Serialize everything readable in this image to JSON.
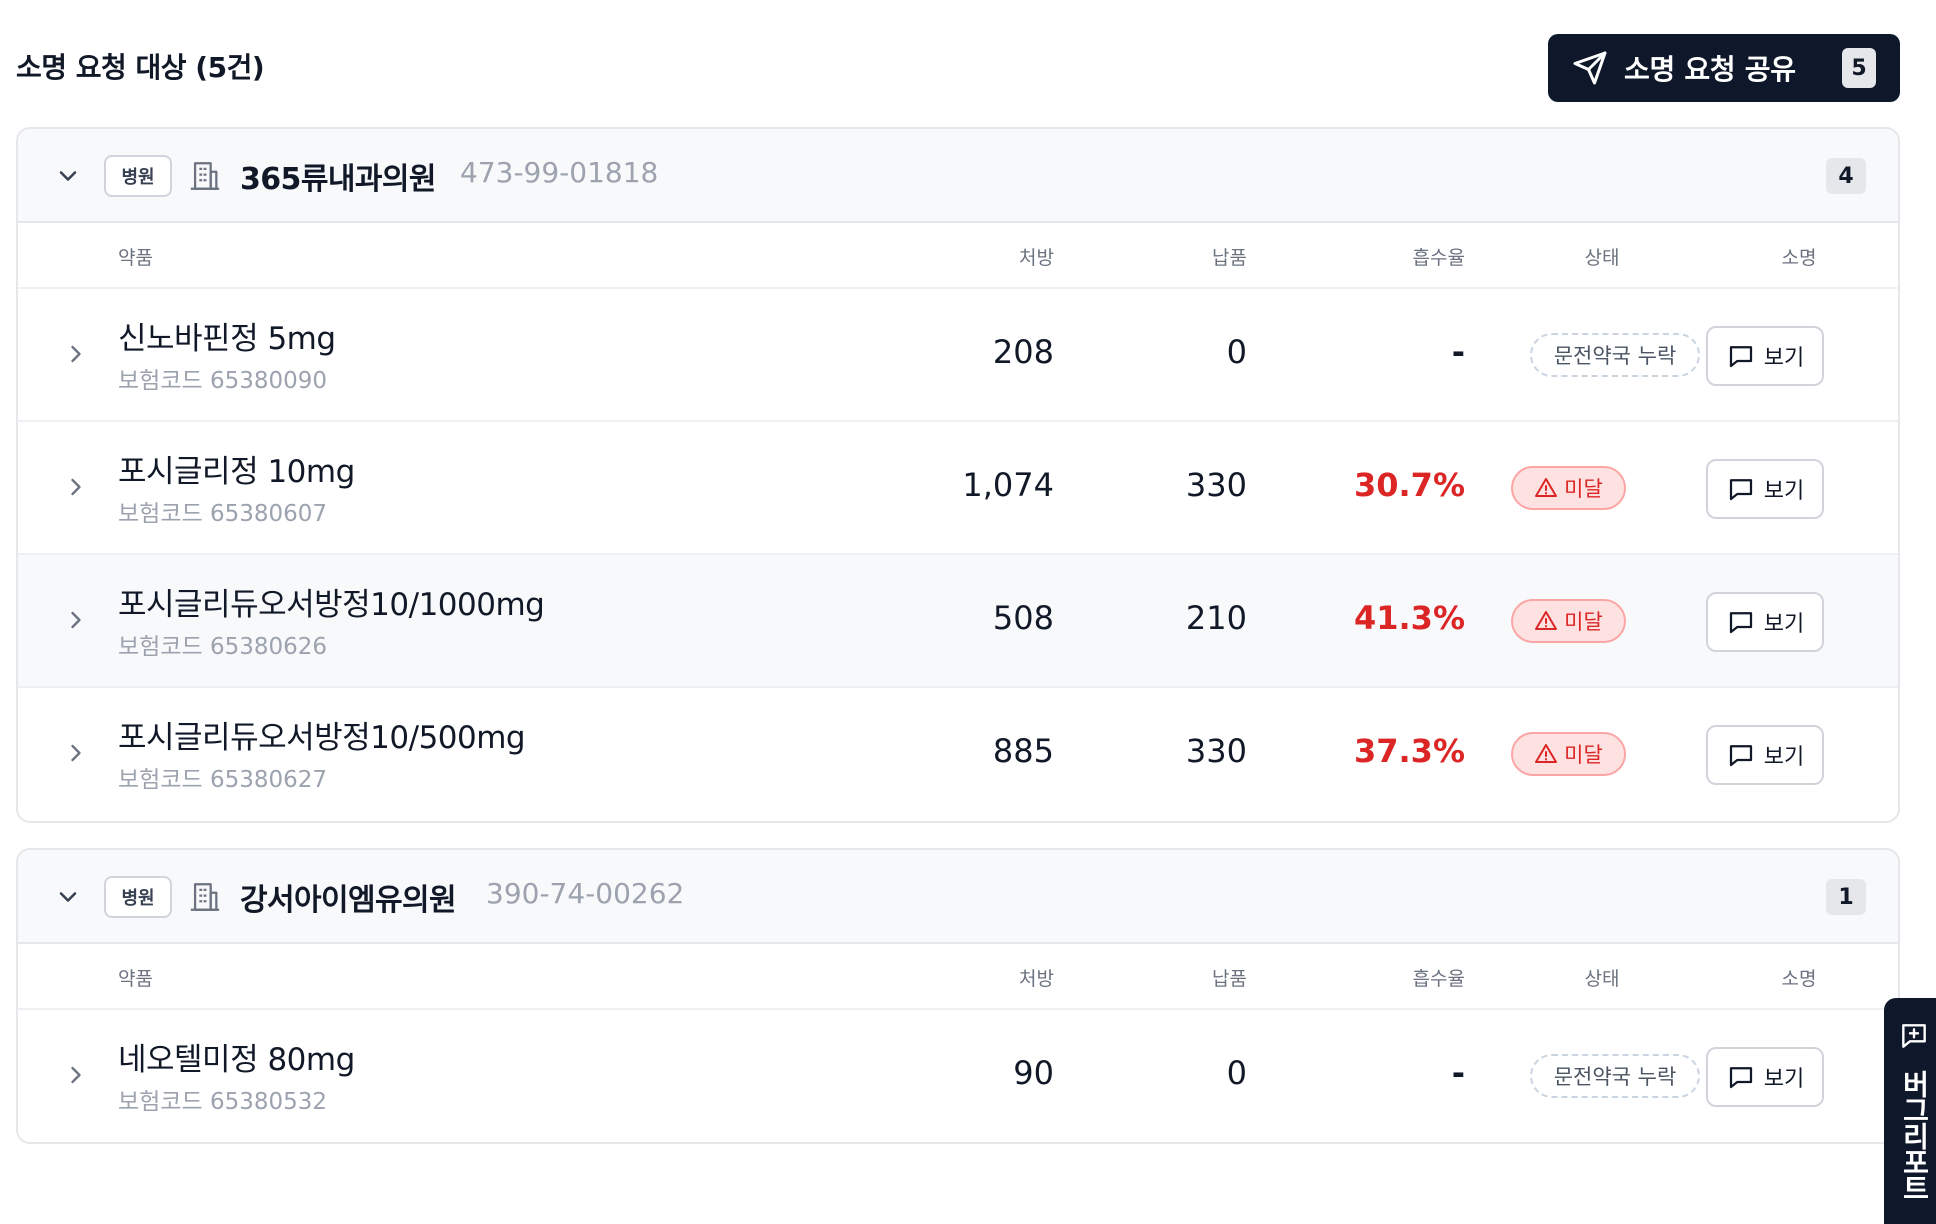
{
  "header": {
    "title": "소명 요청 대상 (5건)",
    "share_label": "소명 요청 공유",
    "share_count": "5"
  },
  "columns": {
    "drug": "약품",
    "rx": "처방",
    "delivery": "납품",
    "rate": "흡수율",
    "status": "상태",
    "explain": "소명"
  },
  "groups": [
    {
      "type": "병원",
      "name": "365류내과의원",
      "code": "473-99-01818",
      "count": "4",
      "rows": [
        {
          "name": "신노바핀정 5mg",
          "code": "보험코드 65380090",
          "rx": "208",
          "delivery": "0",
          "rate": "-",
          "status": "문전약국 누락",
          "view": "보기"
        },
        {
          "name": "포시글리정 10mg",
          "code": "보험코드 65380607",
          "rx": "1,074",
          "delivery": "330",
          "rate": "30.7%",
          "status": "미달",
          "view": "보기"
        },
        {
          "name": "포시글리듀오서방정10/1000mg",
          "code": "보험코드 65380626",
          "rx": "508",
          "delivery": "210",
          "rate": "41.3%",
          "status": "미달",
          "view": "보기"
        },
        {
          "name": "포시글리듀오서방정10/500mg",
          "code": "보험코드 65380627",
          "rx": "885",
          "delivery": "330",
          "rate": "37.3%",
          "status": "미달",
          "view": "보기"
        }
      ]
    },
    {
      "type": "병원",
      "name": "강서아이엠유의원",
      "code": "390-74-00262",
      "count": "1",
      "rows": [
        {
          "name": "네오텔미정 80mg",
          "code": "보험코드 65380532",
          "rx": "90",
          "delivery": "0",
          "rate": "-",
          "status": "문전약국 누락",
          "view": "보기"
        }
      ]
    }
  ],
  "bug_report": "버그리포트",
  "colors": {
    "navy": "#0f172a",
    "danger": "#dc2626",
    "danger_bg": "#fee2e2"
  }
}
